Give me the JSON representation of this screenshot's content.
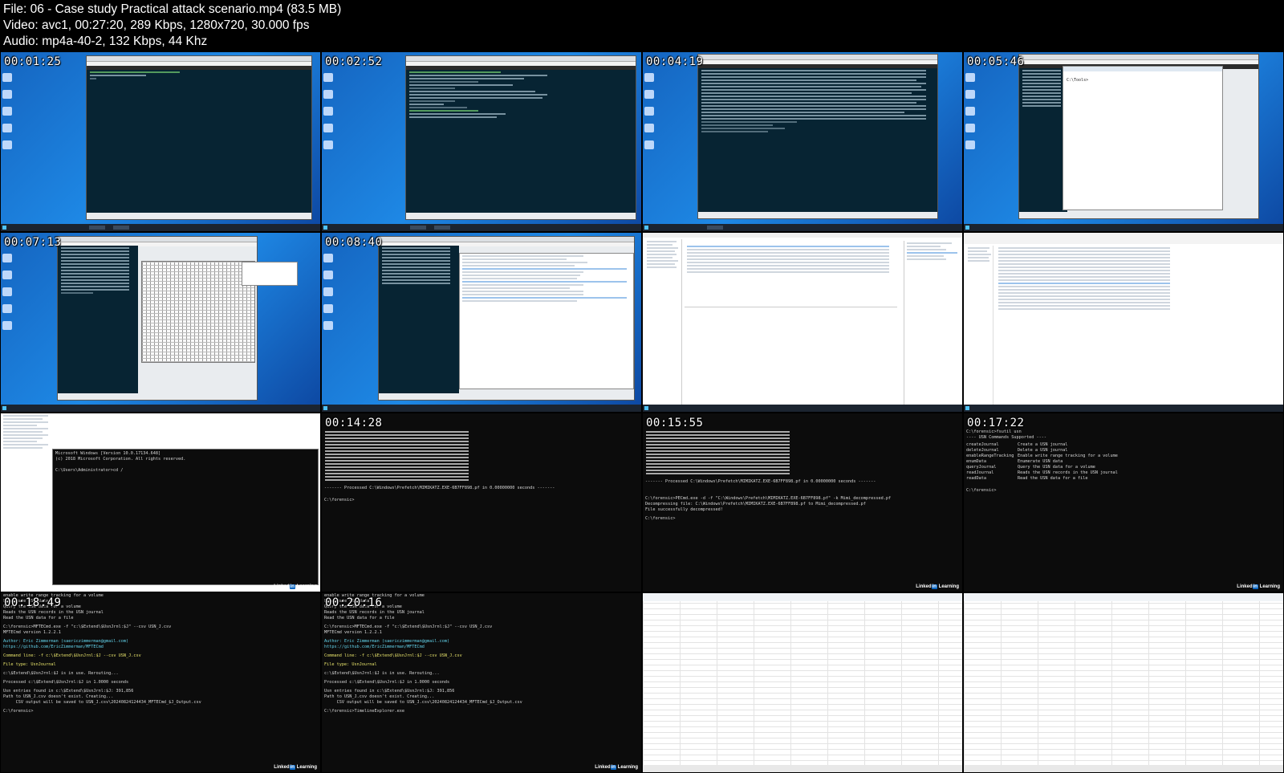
{
  "file_info": {
    "file_line": "File: 06 - Case study Practical attack scenario.mp4 (83.5 MB)",
    "video_line": "Video: avc1, 00:27:20, 289 Kbps, 1280x720, 30.000 fps",
    "audio_line": "Audio: mp4a-40-2, 132 Kbps, 44 Khz"
  },
  "thumbnails": [
    {
      "timestamp": "00:01:25",
      "scene": "desktop-vm-terminal"
    },
    {
      "timestamp": "00:02:52",
      "scene": "desktop-vm-terminal-text"
    },
    {
      "timestamp": "00:04:19",
      "scene": "desktop-vm-process-list"
    },
    {
      "timestamp": "00:05:46",
      "scene": "desktop-vm-process-list-prompt"
    },
    {
      "timestamp": "00:07:13",
      "scene": "desktop-process-hex-editor"
    },
    {
      "timestamp": "00:08:40",
      "scene": "desktop-process-registry"
    },
    {
      "timestamp": "",
      "scene": "event-viewer"
    },
    {
      "timestamp": "",
      "scene": "file-explorer-list"
    },
    {
      "timestamp": "",
      "scene": "explorer-cmd-window"
    },
    {
      "timestamp": "00:14:28",
      "scene": "prefetch-dll-list"
    },
    {
      "timestamp": "00:15:55",
      "scene": "prefetch-dll-list-decompress"
    },
    {
      "timestamp": "00:17:22",
      "scene": "fsutil-usn"
    },
    {
      "timestamp": "00:18:49",
      "scene": "mftecmd-output"
    },
    {
      "timestamp": "00:20:16",
      "scene": "mftecmd-output-timeline"
    },
    {
      "timestamp": "",
      "scene": "timeline-explorer-grid"
    },
    {
      "timestamp": "",
      "scene": "timeline-explorer-grid-dates"
    }
  ],
  "overlay": {
    "brand_text": "Linked",
    "brand_suffix": "in",
    "brand_tail": " Learning"
  },
  "terminal_text": {
    "cmd_banner": "Microsoft Windows [Version 10.0.17134.648]\n(c) 2018 Microsoft Corporation. All rights reserved.\n\nC:\\Users\\Administrator>cd /",
    "prefetch_processed": "------- Processed C:\\Windows\\Prefetch\\MIMIKATZ.EXE-6B7FF898.pf in 0.00000000 seconds -------",
    "forensic_prompt": "C:\\forensic>",
    "pecmd_decompress": "C:\\forensic>PECmd.exe -d -f \"C:\\Windows\\Prefetch\\MIMIKATZ.EXE-6B7FF898.pf\" -k Mimi_decompressed.pf\nDecompressing file: C:\\Windows\\Prefetch\\MIMIKATZ.EXE-6B7FF898.pf to Mimi_decompressed.pf\nFile successfully decompressed!",
    "fsutil_header": "C:\\forensic>fsutil usn\n---- USN Commands Supported ----",
    "fsutil_commands": [
      [
        "createJournal",
        "Create a USN journal"
      ],
      [
        "deleteJournal",
        "Delete a USN journal"
      ],
      [
        "enableRangeTracking",
        "Enable write range tracking for a volume"
      ],
      [
        "enumData",
        "Enumerate USN data"
      ],
      [
        "queryJournal",
        "Query the USN data for a volume"
      ],
      [
        "readJournal",
        "Reads the USN records in the USN journal"
      ],
      [
        "readData",
        "Read the USN data for a file"
      ]
    ],
    "mft_top": "enable write range tracking for a volume\nEnumerate USN data\nQuery the USN data for a volume\nReads the USN records in the USN journal\nRead the USN data for a file",
    "mft_cmd": "C:\\forensic>MFTECmd.exe -f \"c:\\$Extend\\$UsnJrnl:$J\" --csv USN_J.csv\nMFTECmd version 1.2.2.1",
    "mft_author": "Author: Eric Zimmerman (saericzimmerman@gmail.com)\nhttps://github.com/EricZimmerman/MFTECmd",
    "mft_cmdline": "Command line: -f c:\\$Extend\\$UsnJrnl:$J --csv USN_J.csv",
    "mft_filetype": "File type: UsnJournal",
    "mft_inuse": "c:\\$Extend\\$UsnJrnl:$J is in use. Rerouting...",
    "mft_processed": "Processed c:\\$Extend\\$UsnJrnl:$J in 1.0000 seconds",
    "mft_entries": "Usn entries found in c:\\$Extend\\$UsnJrnl:$J: 391,856\nPath to USN_J.csv doesn't exist. Creating...\n     CSV output will be saved to USN_J.csv\\20240824124434_MFTECmd_$J_Output.csv",
    "timeline_cmd": "C:\\forensic>TimelineExplorer.exe"
  }
}
